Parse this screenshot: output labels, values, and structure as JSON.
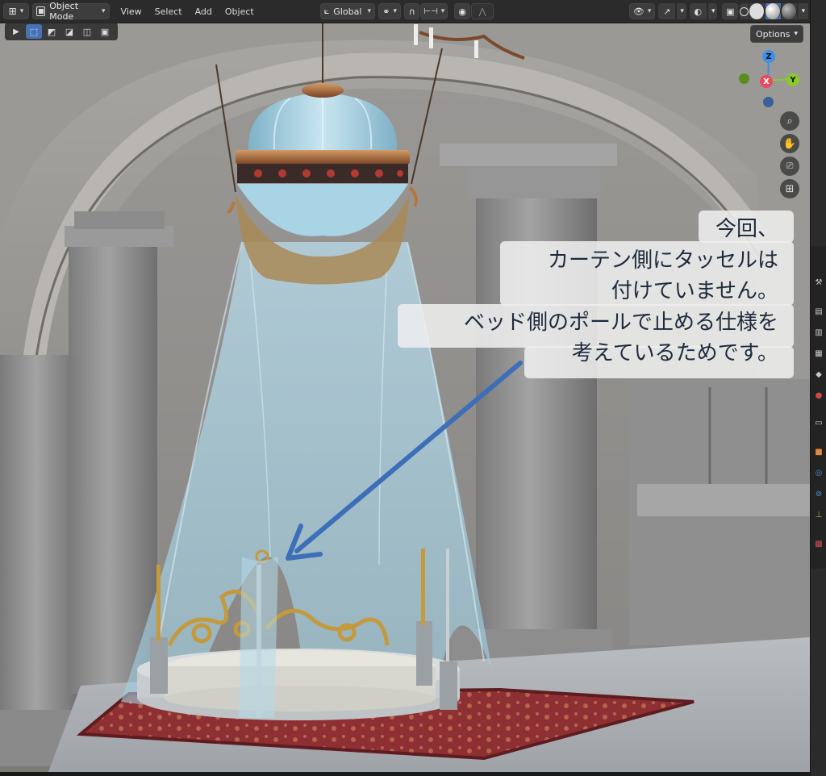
{
  "header": {
    "editor_icon": "editor-type-icon",
    "mode": {
      "label": "Object Mode",
      "icon": "object-mode-icon"
    },
    "menus": [
      "View",
      "Select",
      "Add",
      "Object"
    ],
    "orientation": {
      "label": "Global",
      "icon": "transform-orientation-icon"
    },
    "pivot_icon": "pivot-link-icon",
    "snap_icon": "snap-magnet-icon",
    "snap_target_icon": "snap-increment-icon",
    "proportional_icon": "proportional-edit-icon",
    "falloff_icon": "falloff-curve-icon",
    "visibility_icon": "eye-visibility-icon",
    "gizmo_icon": "gizmo-arrow-icon",
    "overlay_icon": "overlay-icon",
    "xray_icon": "xray-icon",
    "shading_modes": [
      "wireframe",
      "solid",
      "material",
      "rendered"
    ],
    "shading_active": "material"
  },
  "toolbar": {
    "tools": [
      {
        "name": "select-cursor-icon",
        "active": false,
        "glyph": "▶"
      },
      {
        "name": "select-box-new-icon",
        "active": true,
        "glyph": "⬚"
      },
      {
        "name": "select-box-extend-icon",
        "active": false,
        "glyph": "▪"
      },
      {
        "name": "select-box-subtract-icon",
        "active": false,
        "glyph": "◪"
      },
      {
        "name": "select-box-invert-icon",
        "active": false,
        "glyph": "◫"
      },
      {
        "name": "select-box-intersect-icon",
        "active": false,
        "glyph": "▣"
      }
    ]
  },
  "options_label": "Options",
  "gizmo": {
    "z": "Z",
    "y": "Y",
    "x": "X"
  },
  "nav_buttons": [
    "zoom-icon",
    "pan-hand-icon",
    "camera-icon",
    "grid-ortho-icon"
  ],
  "annotation": {
    "lines": [
      "今回、",
      "カーテン側にタッセルは",
      "付けていません。",
      "ベッド側のポールで止める仕様を",
      "考えているためです。"
    ]
  },
  "colors": {
    "header_bg": "#2b2b2b",
    "accent_blue": "#4772b3",
    "arrow_blue": "#3d6fb8",
    "curtain": "#a9d3e6",
    "gizmo_x": "#e84a5f",
    "gizmo_y": "#8ac926",
    "gizmo_z": "#3f8ee8"
  }
}
